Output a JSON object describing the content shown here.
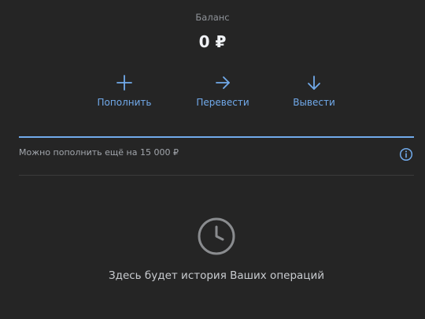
{
  "balance": {
    "caption": "Баланс",
    "amount": "0 ₽"
  },
  "actions": [
    {
      "label": "Пополнить",
      "icon": "plus-icon"
    },
    {
      "label": "Перевести",
      "icon": "arrow-right-icon"
    },
    {
      "label": "Вывести",
      "icon": "arrow-down-icon"
    }
  ],
  "limit": {
    "text": "Можно пополнить ещё на 15 000 ₽",
    "progress": 1.0,
    "info_icon": "info-icon"
  },
  "history": {
    "icon": "clock-icon",
    "empty_text": "Здесь будет история Ваших операций"
  },
  "colors": {
    "background": "#252525",
    "accent": "#71aaeb",
    "muted_text": "#8f9399",
    "icon_gray": "#8a8c8f"
  }
}
